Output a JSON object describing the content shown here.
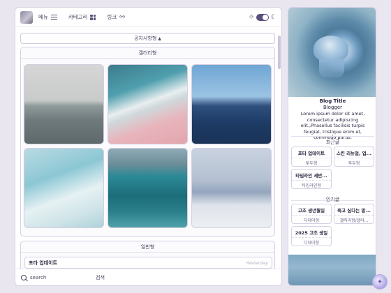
{
  "header": {
    "menu_label": "메뉴",
    "category_label": "카테고리",
    "link_label": "링크"
  },
  "notice": {
    "label": "공지사항형"
  },
  "gallery": {
    "title": "갤러리형",
    "photos": [
      "ocean-fog",
      "pink-beach-waves",
      "deep-blue-sea",
      "white-foam-waves",
      "teal-waves",
      "misty-beach"
    ]
  },
  "general": {
    "title": "일반형",
    "post": {
      "title": "포타 업데이트",
      "date": "Yesterday"
    }
  },
  "search": {
    "placeholder": "search",
    "button_label": "검색"
  },
  "sidebar": {
    "blog_title": "Blog Title",
    "author": "Blogger",
    "description": "Lorem ipsum dolor sit amet, consectetur adipiscing elit.,Phasellus facilisis turpis feugiat, tristique enim et, commodo purus.",
    "recent_title": "최근글",
    "recent": [
      {
        "title": "포타 업데이트",
        "category": "투두형"
      },
      {
        "title": "스킨 리뉴얼, 업...",
        "category": "투두형"
      },
      {
        "title": "타임라인 세반...",
        "category": "타임라인형"
      }
    ],
    "popular_title": "인기글",
    "popular": [
      {
        "title": "고조 생년월일",
        "category": "디데이형"
      },
      {
        "title": "죽고 싶다는 말...",
        "category": "갤러리형/갤러..."
      },
      {
        "title": "2025 고조 생일",
        "category": "디데이형"
      }
    ]
  },
  "colors": {
    "accent": "#5b4f7e",
    "border": "#d6d0e4",
    "background": "#e9e6f0"
  }
}
